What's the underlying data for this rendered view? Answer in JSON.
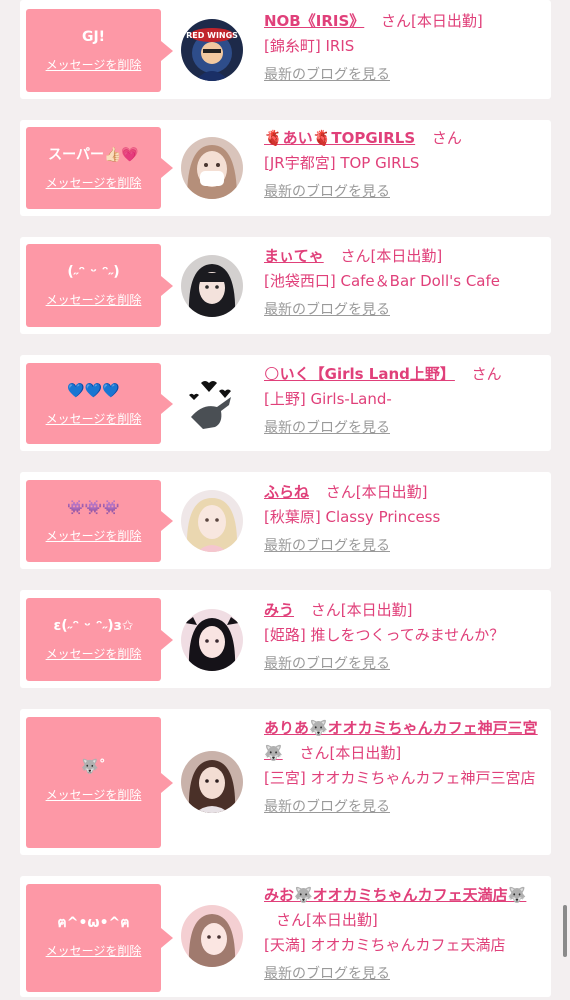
{
  "delete_label": "メッセージを削除",
  "blog_label": "最新のブログを見る",
  "san_label": "さん",
  "accent_color": "#fd98a6",
  "link_color": "#e0407a",
  "items": [
    {
      "message": "GJ!",
      "name": "NOB《IRIS》",
      "status": "さん[本日出勤]",
      "location": "[錦糸町] IRIS",
      "avatar": "avatar-red-wings"
    },
    {
      "message": "スーパー👍🏻💗",
      "name": "🫀あい🫀TOPGIRLS",
      "status": "さん",
      "location": "[JR宇都宮] TOP GIRLS",
      "avatar": "avatar-girl-mask"
    },
    {
      "message": "(˶ᵔ ᵕ ᵔ˶)",
      "name": "まぃてゃ",
      "status": "さん[本日出勤]",
      "location": "[池袋西口] Cafe＆Bar Doll's Cafe",
      "avatar": "avatar-dark-hair"
    },
    {
      "message": "💙💙💙",
      "name": "🌕いく【Girls Land上野】",
      "status": "さん",
      "location": "[上野] Girls-Land-",
      "avatar": "avatar-dinosaur"
    },
    {
      "message": "👾👾👾",
      "name": "ふらね",
      "status": "さん[本日出勤]",
      "location": "[秋葉原] Classy Princess",
      "avatar": "avatar-blonde"
    },
    {
      "message": "ɛ(˶ᵔ ᵕ ᵔ˶)з✩",
      "name": "みう",
      "status": "さん[本日出勤]",
      "location": "[姫路] 推しをつくってみませんか？",
      "avatar": "avatar-twintail"
    },
    {
      "message": "🐺˚",
      "name": "ありあ🐺オオカミちゃんカフェ神戸三宮🐺",
      "status": "さん[本日出勤]",
      "location": "[三宮] オオカミちゃんカフェ神戸三宮店",
      "avatar": "avatar-brown-hair"
    },
    {
      "message": "ฅ^•ω•^ฅ",
      "name": "みお🐺オオカミちゃんカフェ天満店🐺",
      "status": "さん[本日出勤]",
      "location": "[天満] オオカミちゃんカフェ天満店",
      "avatar": "avatar-pink-tone"
    }
  ]
}
